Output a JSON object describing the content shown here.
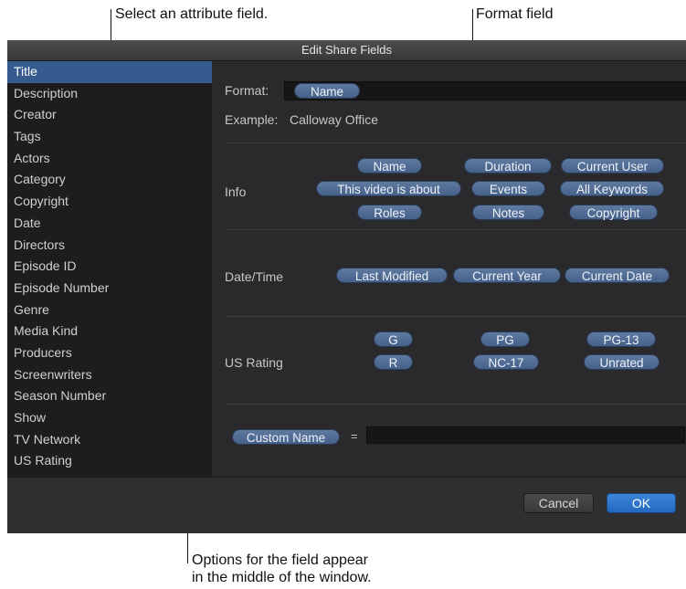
{
  "callouts": {
    "attribute": "Select an attribute field.",
    "format": "Format field",
    "options_line1": "Options for the field appear",
    "options_line2": "in the middle of the window."
  },
  "window": {
    "title": "Edit Share Fields"
  },
  "sidebar": {
    "selected": "Title",
    "items": [
      "Title",
      "Description",
      "Creator",
      "Tags",
      "Actors",
      "Category",
      "Copyright",
      "Date",
      "Directors",
      "Episode ID",
      "Episode Number",
      "Genre",
      "Media Kind",
      "Producers",
      "Screenwriters",
      "Season Number",
      "Show",
      "TV Network",
      "US Rating"
    ]
  },
  "format": {
    "label": "Format:",
    "token": "Name",
    "example_label": "Example:",
    "example_value": "Calloway Office"
  },
  "info": {
    "label": "Info",
    "tokens": [
      "Name",
      "Duration",
      "Current User",
      "This video is about",
      "Events",
      "All Keywords",
      "Roles",
      "Notes",
      "Copyright"
    ]
  },
  "datetime": {
    "label": "Date/Time",
    "tokens": [
      "Last Modified",
      "Current Year",
      "Current Date"
    ]
  },
  "us_rating": {
    "label": "US Rating",
    "tokens": [
      "G",
      "PG",
      "PG-13",
      "R",
      "NC-17",
      "Unrated"
    ]
  },
  "custom": {
    "token": "Custom Name",
    "equals": "=",
    "value": ""
  },
  "buttons": {
    "cancel": "Cancel",
    "ok": "OK"
  },
  "colors": {
    "selection": "#375b8f",
    "token": "#4f6a93",
    "ok_button": "#2b73cc"
  }
}
